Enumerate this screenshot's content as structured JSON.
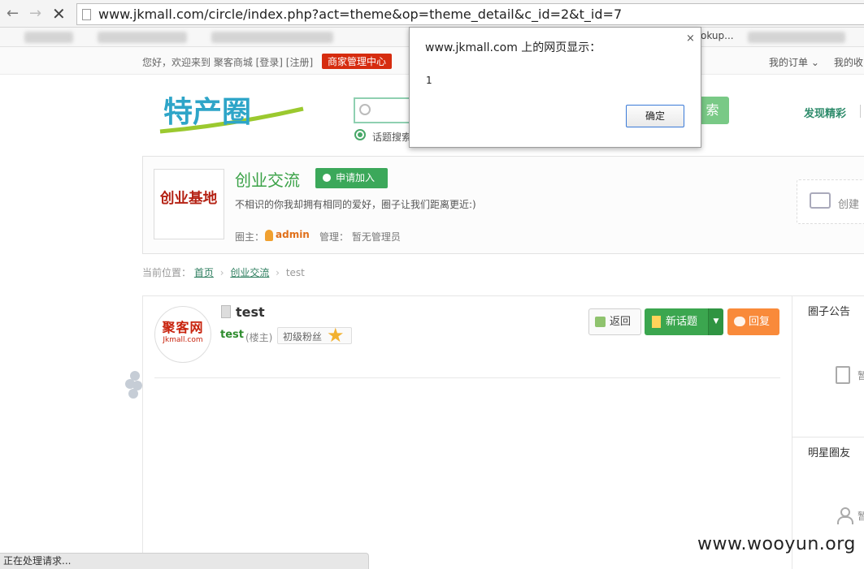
{
  "browser": {
    "url": "www.jkmall.com/circle/index.php?act=theme&op=theme_detail&c_id=2&t_id=7",
    "bookmark_visible": "okup..."
  },
  "topbar": {
    "welcome": "您好，欢迎来到 聚客商城 [登录] [注册]",
    "merchant_center": "商家管理中心",
    "my_orders": "我的订单 ⌄",
    "my_favorites": "我的收"
  },
  "header": {
    "logo_text": "特产圈",
    "search_button": "索",
    "search_option": "话题搜索",
    "discover": "发现精彩"
  },
  "circle": {
    "logo_text": "创业基地",
    "name": "创业交流",
    "join_button": "申请加入",
    "description": "不相识的你我却拥有相同的爱好，圈子让我们距离更近:)",
    "owner_label": "圈主：",
    "owner_name": "admin",
    "managers": "管理：  暂无管理员",
    "create": "创建"
  },
  "breadcrumb": {
    "prefix": "当前位置：",
    "home": "首页",
    "circle": "创业交流",
    "current": "test"
  },
  "thread": {
    "avatar_text_cn": "聚客网",
    "avatar_text_en": "Jkmall.com",
    "title": "test",
    "author": "test",
    "author_role": "(楼主)",
    "rank": "初级粉丝",
    "back_button": "返回",
    "new_topic_button": "新话题",
    "reply_button": "回复"
  },
  "sidebar": {
    "announcement_title": "圈子公告",
    "announcement_empty": "暂",
    "friends_title": "明星圈友",
    "friends_empty": "暂"
  },
  "dialog": {
    "title": "www.jkmall.com 上的网页显示：",
    "close": "×",
    "message": "1",
    "ok_button": "确定"
  },
  "status": {
    "text": "正在处理请求..."
  },
  "watermark": "www.wooyun.org"
}
